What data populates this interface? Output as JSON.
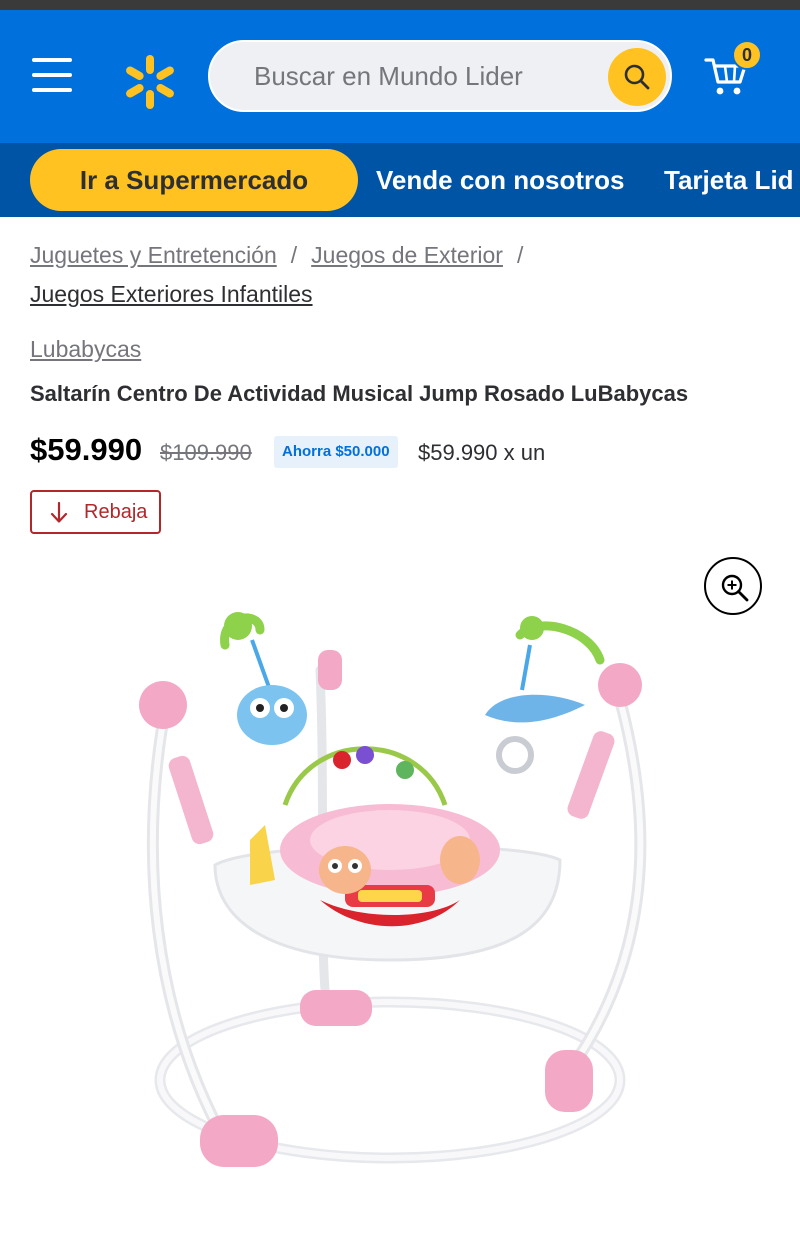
{
  "header": {
    "search_placeholder": "Buscar en Mundo Lider",
    "cart_count": "0",
    "brand_color": "#0071dc",
    "accent_color": "#ffc220",
    "icons": [
      "menu-icon",
      "walmart-spark-icon",
      "search-icon",
      "cart-icon"
    ]
  },
  "subnav": {
    "pill_label": "Ir a Supermercado",
    "links": [
      "Vende con nosotros",
      "Tarjeta Lid"
    ]
  },
  "breadcrumb": {
    "items": [
      "Juguetes y Entretención",
      "Juegos de Exterior",
      "Juegos Exteriores Infantiles"
    ],
    "separator": "/"
  },
  "product": {
    "brand": "Lubabycas",
    "title": "Saltarín Centro De Actividad Musical Jump Rosado LuBabycas",
    "price": "$59.990",
    "old_price": "$109.990",
    "saving": "Ahorra $50.000",
    "unit_price": "$59.990 x un",
    "badge": "Rebaja",
    "badge_color": "#b3262a",
    "image_alt": "Saltarín Centro De Actividad Musical Jump Rosado"
  }
}
